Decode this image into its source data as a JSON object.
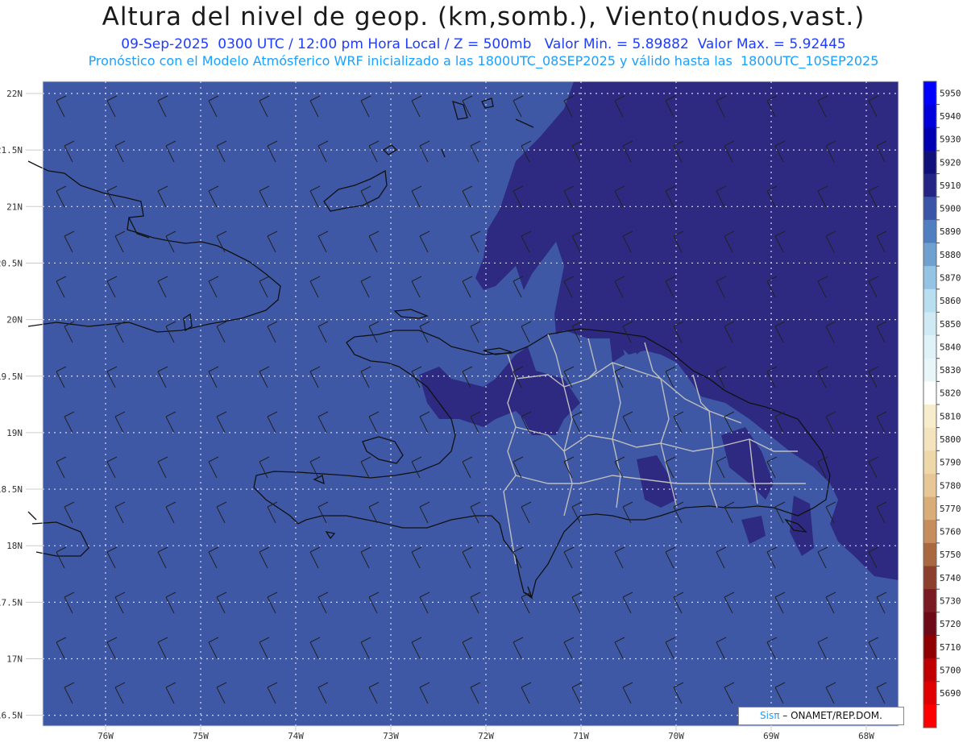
{
  "title": "Altura del nivel de geop. (km,somb.), Viento(nudos,vast.)",
  "subtitle_1": "09-Sep-2025  0300 UTC / 12:00 pm Hora Local / Z = 500mb   Valor Min. = 5.89882  Valor Max. = 5.92445",
  "subtitle_2": "Pronóstico con el Modelo Atmósferico WRF inicializado a las 1800UTC_08SEP2025 y válido hasta las  1800UTC_10SEP2025",
  "lat_labels": [
    "22N",
    "21.5N",
    "21N",
    "20.5N",
    "20N",
    "19.5N",
    "19N",
    "18.5N",
    "18N",
    "17.5N",
    "17N",
    "16.5N"
  ],
  "lat_values": [
    22,
    21.5,
    21,
    20.5,
    20,
    19.5,
    19,
    18.5,
    18,
    17.5,
    17,
    16.5
  ],
  "lon_labels": [
    "76W",
    "75W",
    "74W",
    "73W",
    "72W",
    "71W",
    "70W",
    "69W",
    "68W"
  ],
  "lon_values": [
    -76,
    -75,
    -74,
    -73,
    -72,
    -71,
    -70,
    -69,
    -68
  ],
  "colorbar": {
    "levels": [
      5950,
      5940,
      5930,
      5920,
      5910,
      5900,
      5890,
      5880,
      5870,
      5860,
      5850,
      5840,
      5830,
      5820,
      5810,
      5800,
      5790,
      5780,
      5770,
      5760,
      5750,
      5740,
      5730,
      5720,
      5710,
      5700,
      5690
    ],
    "colors": [
      "#0000ff",
      "#0000dd",
      "#0000b3",
      "#10107a",
      "#252585",
      "#3a55a8",
      "#4f7fc0",
      "#6ea0d0",
      "#94c3e3",
      "#b8def0",
      "#cfe9f5",
      "#dff2f8",
      "#e8f6fa",
      "#ffffff",
      "#f7eccb",
      "#f4e3bc",
      "#eed7a8",
      "#e6c795",
      "#d9ad78",
      "#c68d5d",
      "#a9683f",
      "#8d3e2c",
      "#7a1a22",
      "#6e0a18",
      "#900000",
      "#c00000",
      "#e00000",
      "#ff0000"
    ]
  },
  "fields": {
    "base_color": "#3e58a6",
    "high_color": "#2e2a82"
  },
  "credit": {
    "brand": "Sisπ",
    "text": " – ONAMET/REP.DOM."
  }
}
